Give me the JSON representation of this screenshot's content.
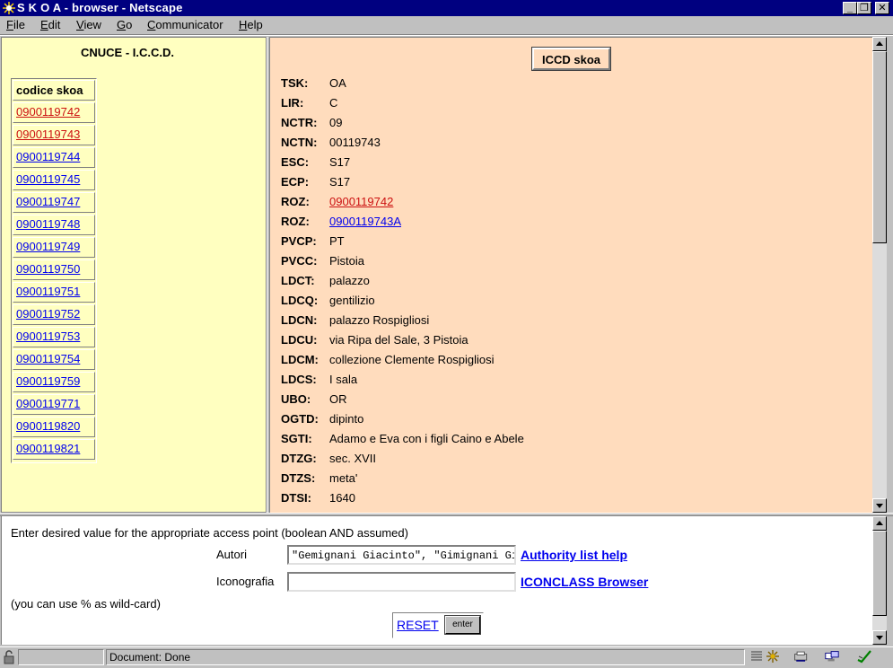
{
  "window": {
    "title": "S K O A - browser - Netscape",
    "controls": {
      "minimize": "_",
      "restore": "❐",
      "close": "✕"
    }
  },
  "menu": [
    {
      "label": "File",
      "key": "F",
      "rest": "ile"
    },
    {
      "label": "Edit",
      "key": "E",
      "rest": "dit"
    },
    {
      "label": "View",
      "key": "V",
      "rest": "iew"
    },
    {
      "label": "Go",
      "key": "G",
      "rest": "o"
    },
    {
      "label": "Communicator",
      "key": "C",
      "rest": "ommunicator"
    },
    {
      "label": "Help",
      "key": "H",
      "rest": "elp"
    }
  ],
  "left_frame": {
    "title": "CNUCE - I.C.C.D.",
    "table_header": "codice skoa",
    "codes": [
      {
        "code": "0900119742",
        "visited": true
      },
      {
        "code": "0900119743",
        "visited": true
      },
      {
        "code": "0900119744",
        "visited": false
      },
      {
        "code": "0900119745",
        "visited": false
      },
      {
        "code": "0900119747",
        "visited": false
      },
      {
        "code": "0900119748",
        "visited": false
      },
      {
        "code": "0900119749",
        "visited": false
      },
      {
        "code": "0900119750",
        "visited": false
      },
      {
        "code": "0900119751",
        "visited": false
      },
      {
        "code": "0900119752",
        "visited": false
      },
      {
        "code": "0900119753",
        "visited": false
      },
      {
        "code": "0900119754",
        "visited": false
      },
      {
        "code": "0900119759",
        "visited": false
      },
      {
        "code": "0900119771",
        "visited": false
      },
      {
        "code": "0900119820",
        "visited": false
      },
      {
        "code": "0900119821",
        "visited": false
      }
    ]
  },
  "right_frame": {
    "button_label": "ICCD skoa",
    "fields": [
      {
        "key": "TSK:",
        "value": "OA"
      },
      {
        "key": "LIR:",
        "value": "C"
      },
      {
        "key": "NCTR:",
        "value": "09"
      },
      {
        "key": "NCTN:",
        "value": "00119743"
      },
      {
        "key": "ESC:",
        "value": "S17"
      },
      {
        "key": "ECP:",
        "value": "S17"
      },
      {
        "key": "ROZ:",
        "value": "0900119742",
        "link": "visited"
      },
      {
        "key": "ROZ:",
        "value": "0900119743A",
        "link": "unvisited"
      },
      {
        "key": "PVCP:",
        "value": "PT"
      },
      {
        "key": "PVCC:",
        "value": "Pistoia"
      },
      {
        "key": "LDCT:",
        "value": "palazzo"
      },
      {
        "key": "LDCQ:",
        "value": "gentilizio"
      },
      {
        "key": "LDCN:",
        "value": "palazzo Rospigliosi"
      },
      {
        "key": "LDCU:",
        "value": "via Ripa del Sale, 3 Pistoia"
      },
      {
        "key": "LDCM:",
        "value": "collezione Clemente Rospigliosi"
      },
      {
        "key": "LDCS:",
        "value": "I sala"
      },
      {
        "key": "UBO:",
        "value": "OR"
      },
      {
        "key": "OGTD:",
        "value": "dipinto"
      },
      {
        "key": "SGTI:",
        "value": "Adamo e Eva con i figli Caino e Abele"
      },
      {
        "key": "DTZG:",
        "value": "sec. XVII"
      },
      {
        "key": "DTZS:",
        "value": "meta'"
      },
      {
        "key": "DTSI:",
        "value": "1640"
      }
    ]
  },
  "search_form": {
    "instructions": "Enter desired value for the appropriate access point (boolean AND assumed)",
    "autori_label": "Autori",
    "autori_value": "\"Gemignani Giacinto\", \"Gimignani Giacinto\"",
    "autori_help": "Authority list help",
    "iconografia_label": "Iconografia",
    "iconografia_value": "",
    "iconografia_help": "ICONCLASS Browser",
    "wildcard_note": "(you can use % as wild-card)",
    "reset_label": "RESET",
    "enter_label": "enter"
  },
  "status": {
    "text": "Document: Done"
  },
  "colors": {
    "titlebar": "#000080",
    "left_bg": "#ffffc0",
    "right_bg": "#ffdcbd",
    "link": "#0000ee",
    "visited_link": "#cc1111"
  }
}
